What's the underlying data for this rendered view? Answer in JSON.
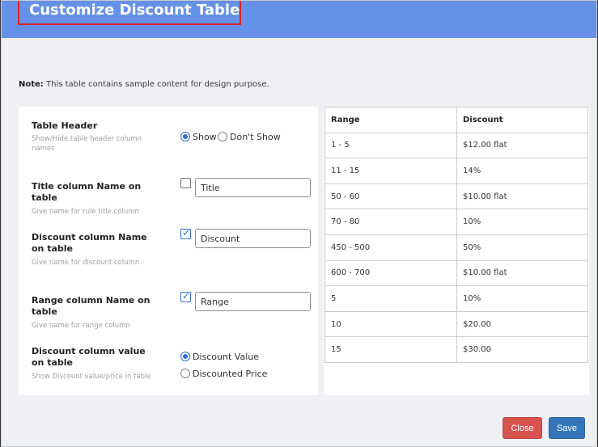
{
  "modal": {
    "title": "Customize Discount Table",
    "note_label": "Note:",
    "note_text": " This table contains sample content for design purpose."
  },
  "settings": {
    "table_header": {
      "label": "Table Header",
      "help": "Show/Hide table header column names",
      "options": [
        "Show",
        "Don't Show"
      ],
      "selected": "Show"
    },
    "title_column": {
      "label": "Title column Name on table",
      "help": "Give name for rule title column",
      "checked": false,
      "value": "Title"
    },
    "discount_column": {
      "label": "Discount column Name on table",
      "help": "Give name for discount column",
      "checked": true,
      "value": "Discount"
    },
    "range_column": {
      "label": "Range column Name on table",
      "help": "Give name for range column",
      "checked": true,
      "value": "Range"
    },
    "discount_value": {
      "label": "Discount column value on table",
      "help": "Show Discount value/price in table",
      "options": [
        "Discount Value",
        "Discounted Price"
      ],
      "selected": "Discount Value"
    }
  },
  "preview": {
    "headers": [
      "Range",
      "Discount"
    ],
    "rows": [
      [
        "1 - 5",
        "$12.00 flat"
      ],
      [
        "11 - 15",
        "14%"
      ],
      [
        "50 - 60",
        "$10.00 flat"
      ],
      [
        "70 - 80",
        "10%"
      ],
      [
        "450 - 500",
        "50%"
      ],
      [
        "600 - 700",
        "$10.00 flat"
      ],
      [
        "5",
        "10%"
      ],
      [
        "10",
        "$20.00"
      ],
      [
        "15",
        "$30.00"
      ]
    ]
  },
  "buttons": {
    "close": "Close",
    "save": "Save"
  },
  "colors": {
    "header": "#6592e6",
    "close": "#d9534f",
    "save": "#3475b8",
    "highlight": "#e0202a"
  }
}
